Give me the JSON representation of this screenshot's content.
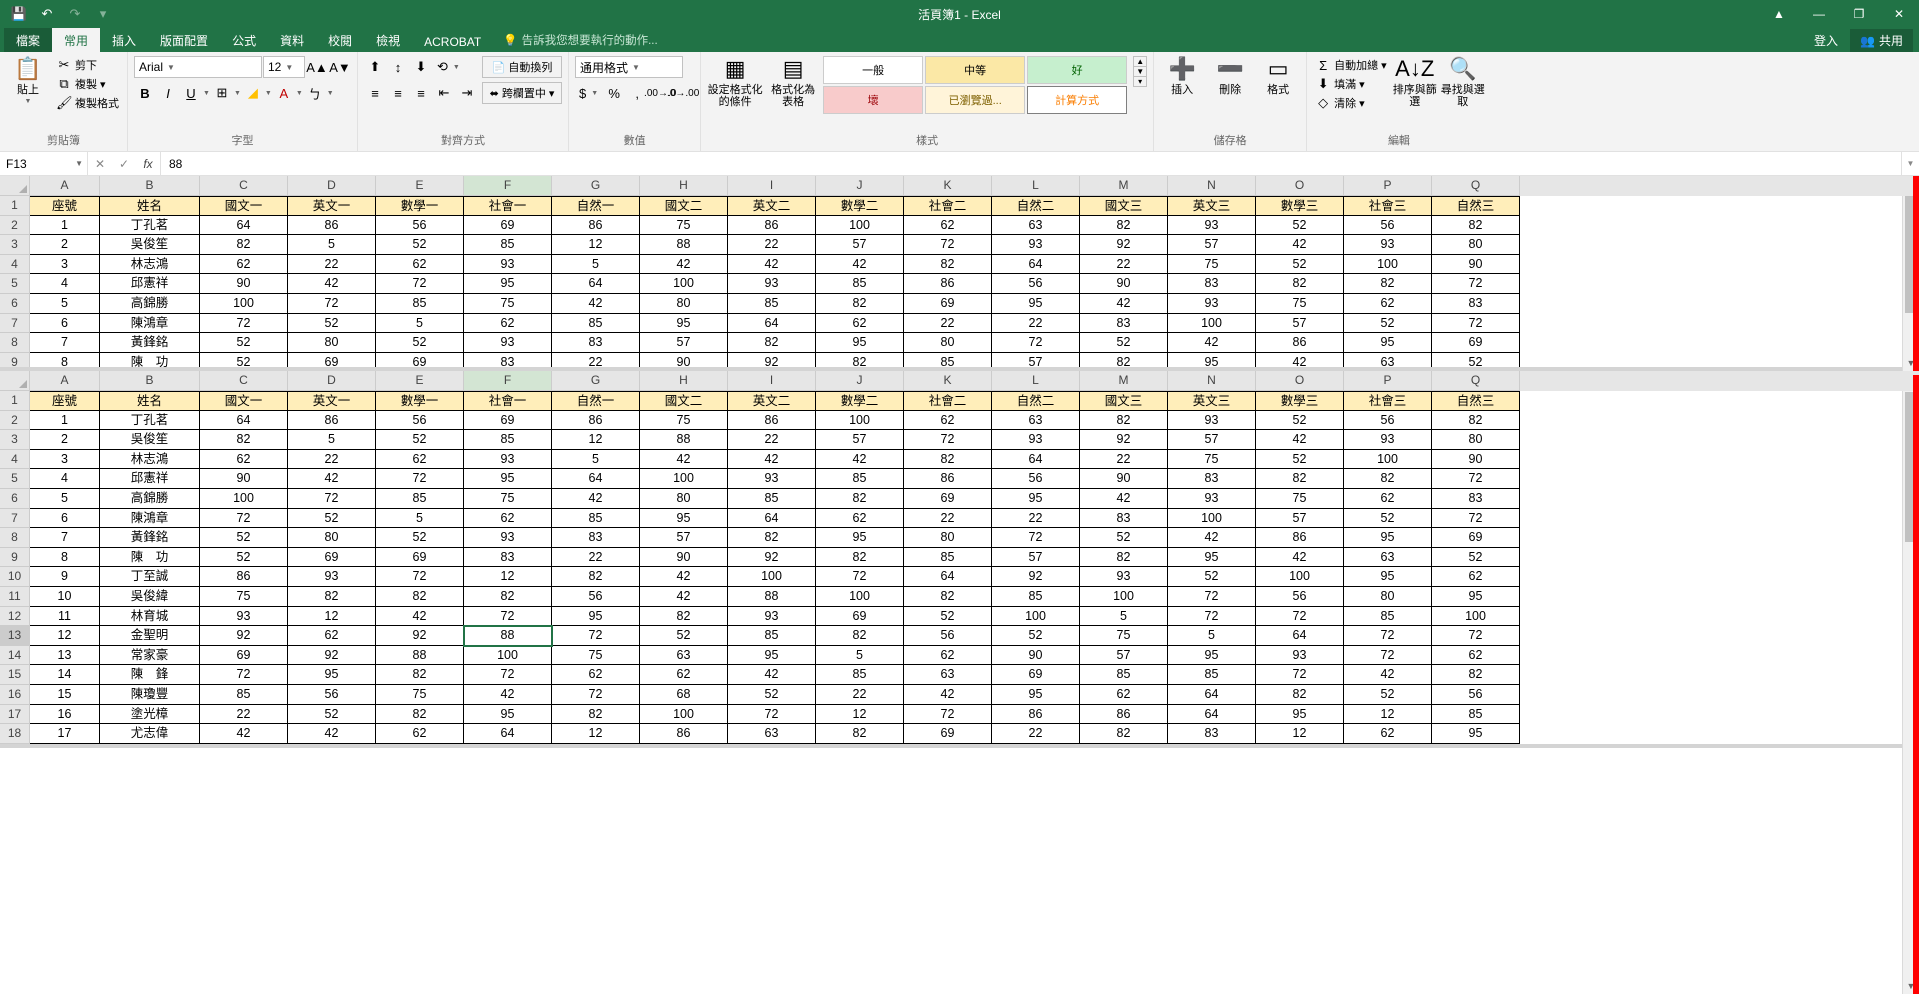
{
  "titlebar": {
    "title": "活頁簿1 - Excel"
  },
  "tabs": {
    "file": "檔案",
    "home": "常用",
    "insert": "插入",
    "layout": "版面配置",
    "formulas": "公式",
    "data": "資料",
    "review": "校閱",
    "view": "檢視",
    "acrobat": "ACROBAT",
    "tellme": "告訴我您想要執行的動作...",
    "signin": "登入",
    "share": "共用"
  },
  "ribbon": {
    "clipboard": {
      "paste": "貼上",
      "cut": "剪下",
      "copy": "複製",
      "painter": "複製格式",
      "label": "剪貼簿"
    },
    "font": {
      "name": "Arial",
      "size": "12",
      "label": "字型"
    },
    "align": {
      "wrap": "自動換列",
      "merge": "跨欄置中",
      "label": "對齊方式"
    },
    "number": {
      "format": "通用格式",
      "label": "數值"
    },
    "styles_group": {
      "cond": "設定格式化的條件",
      "astable": "格式化為表格",
      "normal": "一般",
      "mid": "中等",
      "good": "好",
      "bad": "壞",
      "visited": "已瀏覽過...",
      "calc": "計算方式",
      "label": "樣式"
    },
    "cells": {
      "insert": "插入",
      "delete": "刪除",
      "format": "格式",
      "label": "儲存格"
    },
    "editing": {
      "autosum": "自動加總",
      "fill": "填滿",
      "clear": "清除",
      "sort": "排序與篩選",
      "find": "尋找與選取",
      "label": "編輯"
    }
  },
  "formula_bar": {
    "namebox": "F13",
    "value": "88"
  },
  "columns": [
    "A",
    "B",
    "C",
    "D",
    "E",
    "F",
    "G",
    "H",
    "I",
    "J",
    "K",
    "L",
    "M",
    "N",
    "O",
    "P",
    "Q"
  ],
  "headers": [
    "座號",
    "姓名",
    "國文一",
    "英文一",
    "數學一",
    "社會一",
    "自然一",
    "國文二",
    "英文二",
    "數學二",
    "社會二",
    "自然二",
    "國文三",
    "英文三",
    "數學三",
    "社會三",
    "自然三"
  ],
  "rows": [
    [
      "1",
      "丁孔茗",
      "64",
      "86",
      "56",
      "69",
      "86",
      "75",
      "86",
      "100",
      "62",
      "63",
      "82",
      "93",
      "52",
      "56",
      "82"
    ],
    [
      "2",
      "吳俊笙",
      "82",
      "5",
      "52",
      "85",
      "12",
      "88",
      "22",
      "57",
      "72",
      "93",
      "92",
      "57",
      "42",
      "93",
      "80"
    ],
    [
      "3",
      "林志鴻",
      "62",
      "22",
      "62",
      "93",
      "5",
      "42",
      "42",
      "42",
      "82",
      "64",
      "22",
      "75",
      "52",
      "100",
      "90"
    ],
    [
      "4",
      "邱憲祥",
      "90",
      "42",
      "72",
      "95",
      "64",
      "100",
      "93",
      "85",
      "86",
      "56",
      "90",
      "83",
      "82",
      "82",
      "72"
    ],
    [
      "5",
      "高錦勝",
      "100",
      "72",
      "85",
      "75",
      "42",
      "80",
      "85",
      "82",
      "69",
      "95",
      "42",
      "93",
      "75",
      "62",
      "83"
    ],
    [
      "6",
      "陳鴻章",
      "72",
      "52",
      "5",
      "62",
      "85",
      "95",
      "64",
      "62",
      "22",
      "22",
      "83",
      "100",
      "57",
      "52",
      "72"
    ],
    [
      "7",
      "黃鋒銘",
      "52",
      "80",
      "52",
      "93",
      "83",
      "57",
      "82",
      "95",
      "80",
      "72",
      "52",
      "42",
      "86",
      "95",
      "69"
    ],
    [
      "8",
      "陳　功",
      "52",
      "69",
      "69",
      "83",
      "22",
      "90",
      "92",
      "82",
      "85",
      "57",
      "82",
      "95",
      "42",
      "63",
      "52"
    ],
    [
      "9",
      "丁至誠",
      "86",
      "93",
      "72",
      "12",
      "82",
      "42",
      "100",
      "72",
      "64",
      "92",
      "93",
      "52",
      "100",
      "95",
      "62"
    ],
    [
      "10",
      "吳俊緯",
      "75",
      "82",
      "82",
      "82",
      "56",
      "42",
      "88",
      "100",
      "82",
      "85",
      "100",
      "72",
      "56",
      "80",
      "95"
    ],
    [
      "11",
      "林育城",
      "93",
      "12",
      "42",
      "72",
      "95",
      "82",
      "93",
      "69",
      "52",
      "100",
      "5",
      "72",
      "72",
      "85",
      "100"
    ],
    [
      "12",
      "金聖明",
      "92",
      "62",
      "92",
      "88",
      "72",
      "52",
      "85",
      "82",
      "56",
      "52",
      "75",
      "5",
      "64",
      "72",
      "72"
    ],
    [
      "13",
      "常家豪",
      "69",
      "92",
      "88",
      "100",
      "75",
      "63",
      "95",
      "5",
      "62",
      "90",
      "57",
      "95",
      "93",
      "72",
      "62"
    ],
    [
      "14",
      "陳　鋒",
      "72",
      "95",
      "82",
      "72",
      "62",
      "62",
      "42",
      "85",
      "63",
      "69",
      "85",
      "85",
      "72",
      "42",
      "82"
    ],
    [
      "15",
      "陳瓊豐",
      "85",
      "56",
      "75",
      "42",
      "72",
      "68",
      "52",
      "22",
      "42",
      "95",
      "62",
      "64",
      "82",
      "52",
      "56"
    ],
    [
      "16",
      "塗光樟",
      "22",
      "52",
      "82",
      "95",
      "82",
      "100",
      "72",
      "12",
      "72",
      "86",
      "86",
      "64",
      "95",
      "12",
      "85"
    ],
    [
      "17",
      "尤志偉",
      "42",
      "42",
      "62",
      "64",
      "12",
      "86",
      "63",
      "82",
      "69",
      "22",
      "82",
      "83",
      "12",
      "62",
      "95"
    ]
  ],
  "selected": {
    "cell": "F13",
    "row": 13,
    "col": "F"
  },
  "top_pane_rows": 9
}
